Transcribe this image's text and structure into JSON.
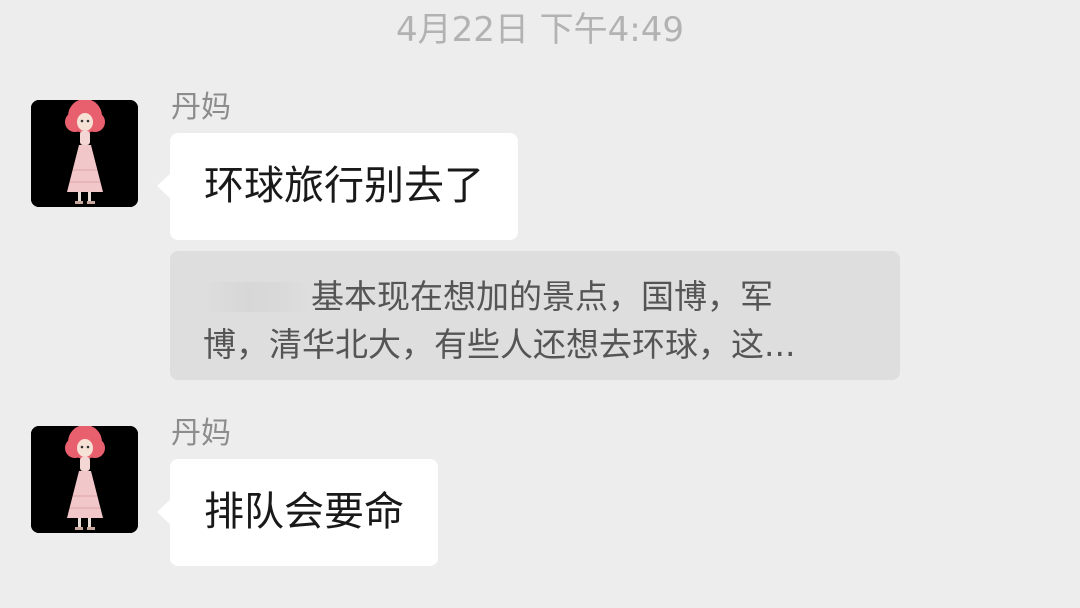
{
  "timestamp": "4月22日 下午4:49",
  "messages": [
    {
      "sender": "丹妈",
      "text": "环球旅行别去了",
      "avatar_icon": "girl-pink-hair-avatar"
    },
    {
      "sender": "丹妈",
      "text": "排队会要命",
      "avatar_icon": "girl-pink-hair-avatar"
    }
  ],
  "quote": {
    "line1": "基本现在想加的景点，国博，军",
    "line2": "博，清华北大，有些人还想去环球，这..."
  },
  "colors": {
    "background": "#ededed",
    "bubble": "#ffffff",
    "quote_bg": "#dedede",
    "avatar_hair": "#e8606e",
    "avatar_dress": "#f2c7c9"
  }
}
